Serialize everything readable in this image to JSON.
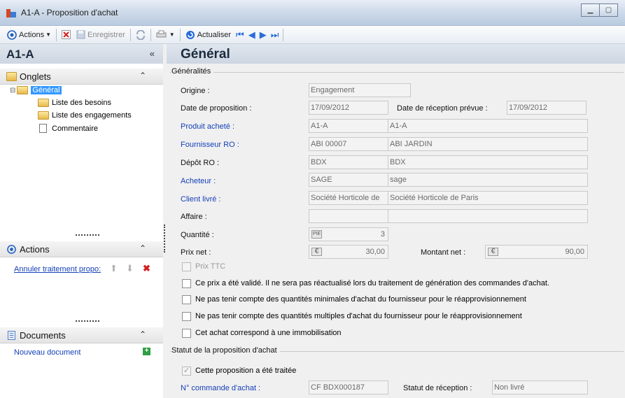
{
  "window": {
    "title": "A1-A -  Proposition d'achat"
  },
  "toolbar": {
    "actions_label": "Actions",
    "save_label": "Enregistrer",
    "refresh_label": "Actualiser"
  },
  "left": {
    "title": "A1-A",
    "collapse": "«",
    "onglets": {
      "title": "Onglets",
      "chevron": "⌃",
      "root": "Général",
      "items": [
        "Liste des besoins",
        "Liste des engagements",
        "Commentaire"
      ]
    },
    "actions": {
      "title": "Actions",
      "chevron": "⌃",
      "item": "Annuler traitement propo:"
    },
    "documents": {
      "title": "Documents",
      "chevron": "⌃",
      "item": "Nouveau document"
    }
  },
  "main": {
    "title": "Général",
    "group1": "Généralités",
    "group2": "Statut de la proposition d'achat",
    "fields": {
      "origine": {
        "label": "Origine :",
        "value": "Engagement"
      },
      "date_prop": {
        "label": "Date de proposition :",
        "value": "17/09/2012"
      },
      "date_recep": {
        "label": "Date de réception prévue :",
        "value": "17/09/2012"
      },
      "produit": {
        "label": "Produit acheté :",
        "code": "A1-A",
        "name": "A1-A"
      },
      "fournisseur": {
        "label": "Fournisseur RO :",
        "code": "ABI 00007",
        "name": "ABI JARDIN"
      },
      "depot": {
        "label": "Dépôt RO :",
        "code": "BDX",
        "name": "BDX"
      },
      "acheteur": {
        "label": "Acheteur :",
        "code": "SAGE",
        "name": "sage"
      },
      "client": {
        "label": "Client livré :",
        "code": "Société Horticole de",
        "name": "Société Horticole de Paris"
      },
      "affaire": {
        "label": "Affaire :"
      },
      "quantite": {
        "label": "Quantité :",
        "unit": "PIE",
        "value": "3"
      },
      "prix": {
        "label": "Prix net :",
        "cur": "€",
        "value": "30,00"
      },
      "montant": {
        "label": "Montant net :",
        "cur": "€",
        "value": "90,00"
      },
      "commande": {
        "label": "N° commande d'achat :",
        "value": "CF BDX000187"
      },
      "statut_recep": {
        "label": "Statut de réception :",
        "value": "Non livré"
      }
    },
    "checks": {
      "prix_ttc": "Prix TTC",
      "valide": "Ce prix a été validé. Il ne sera pas réactualisé lors du traitement de génération des commandes d'achat.",
      "qte_min": "Ne pas tenir compte des quantités minimales d'achat du fournisseur pour le réapprovisionnement",
      "qte_mult": "Ne pas tenir compte des quantités multiples d'achat du fournisseur pour le réapprovisionnement",
      "immo": "Cet achat correspond à une immobilisation",
      "traitee": "Cette proposition a été traitée"
    }
  }
}
